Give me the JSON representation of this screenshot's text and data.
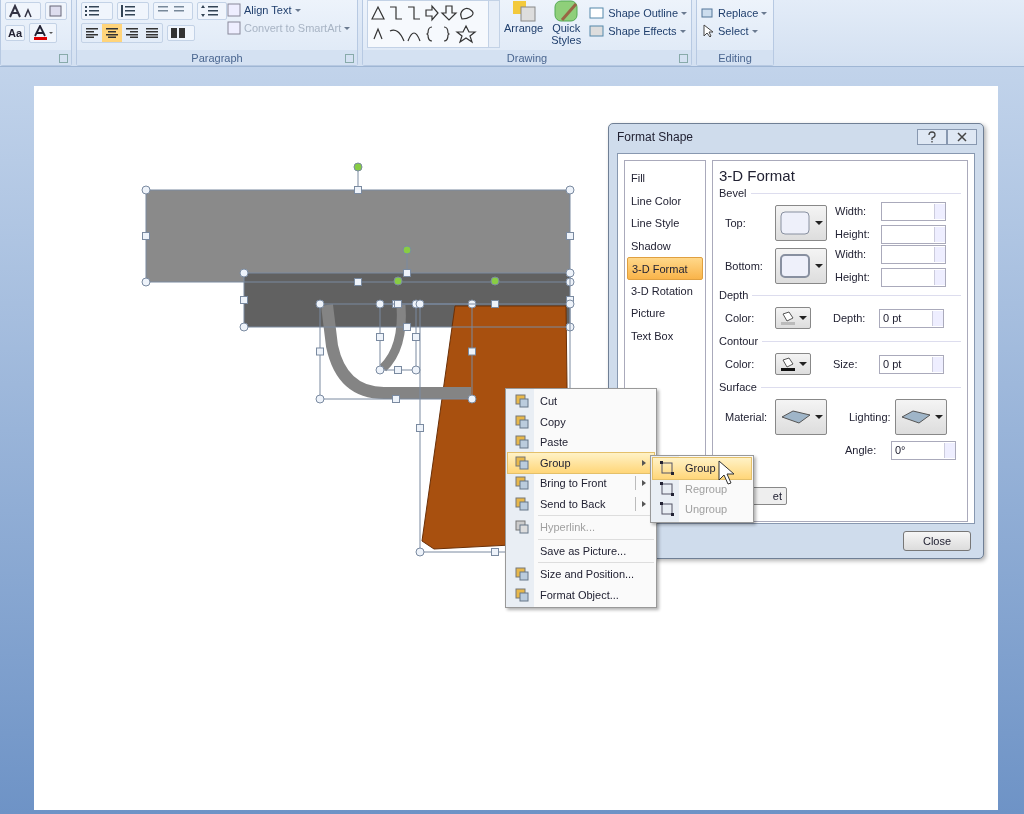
{
  "ribbon": {
    "font_group": {
      "case_button": "Aa"
    },
    "paragraph": {
      "title": "Paragraph",
      "align_buttons": [
        {
          "selected": false
        },
        {
          "selected": true
        },
        {
          "selected": false
        },
        {
          "selected": false
        }
      ],
      "commands": [
        {
          "label": "Align Text",
          "disabled": false
        },
        {
          "label": "Convert to SmartArt",
          "disabled": true
        }
      ]
    },
    "drawing": {
      "title": "Drawing",
      "arrange": "Arrange",
      "quick_styles": "Quick Styles",
      "commands": [
        "Shape Outline",
        "Shape Effects"
      ]
    },
    "editing": {
      "title": "Editing",
      "commands": [
        "Replace",
        "Select"
      ]
    }
  },
  "dialog": {
    "title": "Format Shape",
    "nav": [
      {
        "label": "Fill",
        "selected": false
      },
      {
        "label": "Line Color",
        "selected": false
      },
      {
        "label": "Line Style",
        "selected": false
      },
      {
        "label": "Shadow",
        "selected": false
      },
      {
        "label": "3-D Format",
        "selected": true
      },
      {
        "label": "3-D Rotation",
        "selected": false
      },
      {
        "label": "Picture",
        "selected": false
      },
      {
        "label": "Text Box",
        "selected": false
      }
    ],
    "heading": "3-D Format",
    "bevel": {
      "title": "Bevel",
      "pickers": [
        {
          "label": "Top:",
          "fields": [
            {
              "label": "Width:"
            },
            {
              "label": "Height:"
            }
          ]
        },
        {
          "label": "Bottom:",
          "fields": [
            {
              "label": "Width:"
            },
            {
              "label": "Height:"
            }
          ]
        }
      ]
    },
    "depth": {
      "title": "Depth",
      "color_label": "Color:",
      "field": {
        "label": "Depth:",
        "value": "0 pt"
      }
    },
    "contour": {
      "title": "Contour",
      "color_label": "Color:",
      "field": {
        "label": "Size:",
        "value": "0 pt"
      }
    },
    "surface": {
      "title": "Surface",
      "material_label": "Material:",
      "lighting_label": "Lighting:",
      "angle": {
        "label": "Angle:",
        "value": "0°"
      }
    },
    "reset_button": "et",
    "close_button": "Close"
  },
  "context_menu": [
    {
      "label": "Cut",
      "kind": "command",
      "disabled": false,
      "highlighted": false,
      "separator_before": false
    },
    {
      "label": "Copy",
      "kind": "command",
      "disabled": false,
      "highlighted": false,
      "separator_before": false
    },
    {
      "label": "Paste",
      "kind": "command",
      "disabled": false,
      "highlighted": false,
      "separator_before": false
    },
    {
      "label": "Group",
      "kind": "submenu",
      "disabled": false,
      "highlighted": true,
      "separator_before": false
    },
    {
      "label": "Bring to Front",
      "kind": "split",
      "disabled": false,
      "highlighted": false,
      "separator_before": false
    },
    {
      "label": "Send to Back",
      "kind": "split",
      "disabled": false,
      "highlighted": false,
      "separator_before": false
    },
    {
      "label": "Hyperlink...",
      "kind": "command",
      "disabled": true,
      "highlighted": false,
      "separator_before": true
    },
    {
      "label": "Save as Picture...",
      "kind": "command",
      "disabled": false,
      "highlighted": false,
      "separator_before": true
    },
    {
      "label": "Size and Position...",
      "kind": "command",
      "disabled": false,
      "highlighted": false,
      "separator_before": true
    },
    {
      "label": "Format Object...",
      "kind": "command",
      "disabled": false,
      "highlighted": false,
      "separator_before": false
    }
  ],
  "submenu": [
    {
      "label": "Group",
      "disabled": false,
      "highlighted": true
    },
    {
      "label": "Regroup",
      "disabled": true,
      "highlighted": false
    },
    {
      "label": "Ungroup",
      "disabled": true,
      "highlighted": false
    }
  ]
}
